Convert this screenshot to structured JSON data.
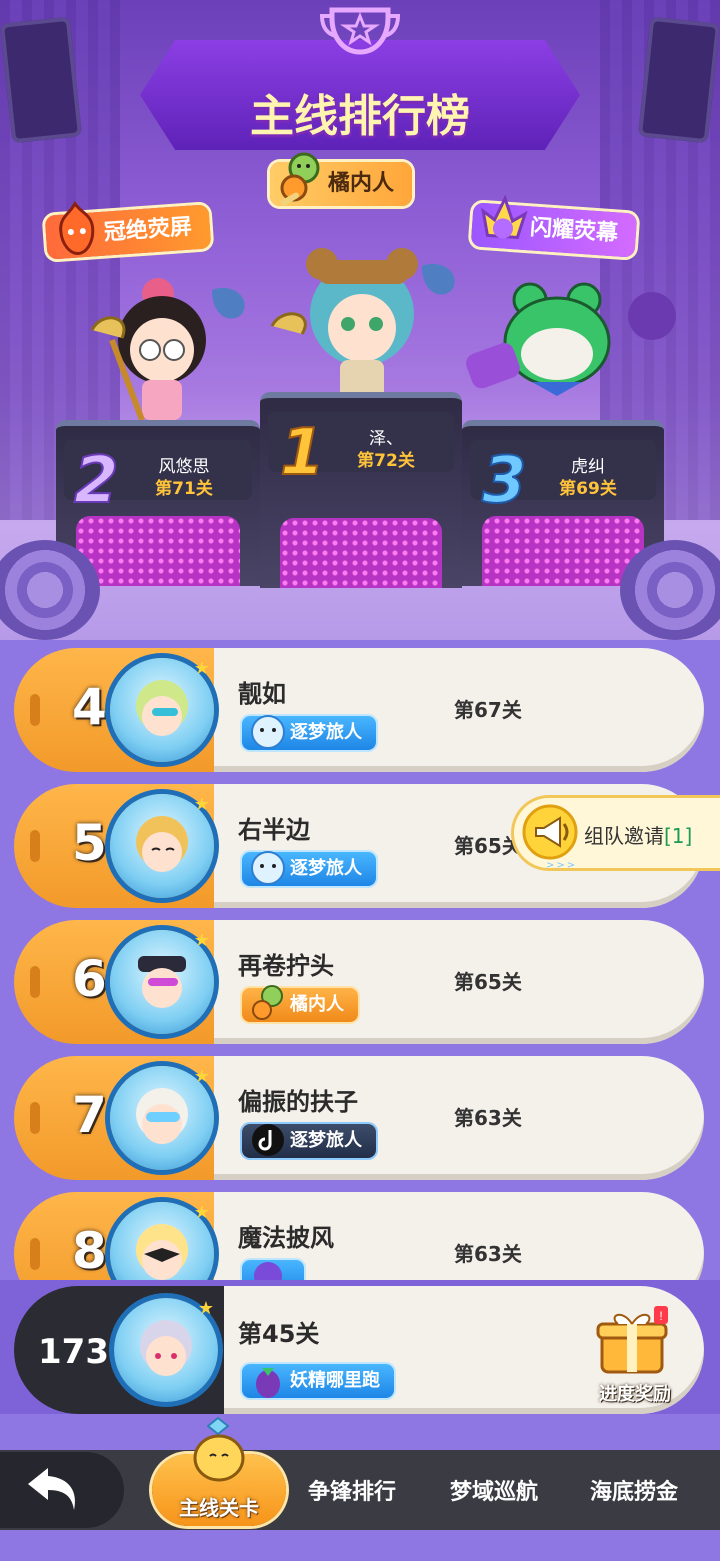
{
  "header": {
    "title": "主线排行榜",
    "titles": {
      "first": "橘内人",
      "second": "冠绝荧屏",
      "third": "闪耀荧幕"
    }
  },
  "podium": [
    {
      "rank": "1",
      "name": "泽、",
      "level": "第72关"
    },
    {
      "rank": "2",
      "name": "风悠思",
      "level": "第71关"
    },
    {
      "rank": "3",
      "name": "虎纠",
      "level": "第69关"
    }
  ],
  "list": [
    {
      "rank": "4",
      "name": "靓如",
      "level": "第67关",
      "badge": "逐梦旅人",
      "badge_style": "blue"
    },
    {
      "rank": "5",
      "name": "右半边",
      "level": "第65关",
      "badge": "逐梦旅人",
      "badge_style": "blue"
    },
    {
      "rank": "6",
      "name": "再卷拧头",
      "level": "第65关",
      "badge": "橘内人",
      "badge_style": "orange"
    },
    {
      "rank": "7",
      "name": "偏振的扶子",
      "level": "第63关",
      "badge": "逐梦旅人",
      "badge_style": "dark"
    },
    {
      "rank": "8",
      "name": "魔法披风",
      "level": "第63关",
      "badge": "",
      "badge_style": "blue"
    }
  ],
  "invite": {
    "label": "组队邀请",
    "count": "[1]"
  },
  "me": {
    "rank": "173",
    "level": "第45关",
    "badge": "妖精哪里跑",
    "reward_label": "进度奖励"
  },
  "nav": {
    "active": "主线关卡",
    "tabs": [
      "争锋排行",
      "梦域巡航",
      "海底捞金"
    ]
  },
  "colors": {
    "accent_orange": "#f7941a",
    "bg_purple": "#8f77e3",
    "gold_text": "#ffc43a"
  }
}
